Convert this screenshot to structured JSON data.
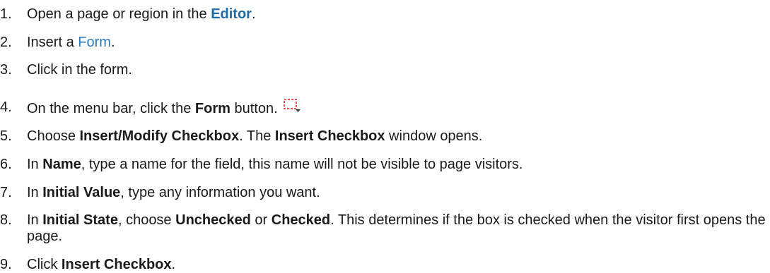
{
  "steps": [
    {
      "number": "1.",
      "parts": [
        "Open a page or region in the ",
        "Editor",
        "."
      ]
    },
    {
      "number": "2.",
      "parts": [
        "Insert a ",
        "Form",
        "."
      ]
    },
    {
      "number": "3.",
      "parts": [
        "Click in the form."
      ]
    },
    {
      "number": "4.",
      "parts": [
        "On the menu bar, click the ",
        "Form",
        " button."
      ],
      "icon": "form-dashed-rect-icon"
    },
    {
      "number": "5.",
      "parts": [
        "Choose ",
        "Insert/Modify Checkbox",
        ". The ",
        "Insert Checkbox",
        " window opens."
      ]
    },
    {
      "number": "6.",
      "parts": [
        "In ",
        "Name",
        ", type a name for the field, this name will not be visible to page visitors."
      ]
    },
    {
      "number": "7.",
      "parts": [
        "In ",
        "Initial Value",
        ", type any information you want."
      ]
    },
    {
      "number": "8.",
      "parts": [
        "In ",
        "Initial State",
        ", choose ",
        "Unchecked",
        " or ",
        "Checked",
        ". This determines if the box is checked when the visitor first opens the page."
      ]
    },
    {
      "number": "9.",
      "parts": [
        "Click ",
        "Insert Checkbox",
        "."
      ]
    }
  ],
  "colors": {
    "editor_link": "#1f6aa5",
    "form_link": "#2a7ab8",
    "icon_dash": "#e02020"
  }
}
